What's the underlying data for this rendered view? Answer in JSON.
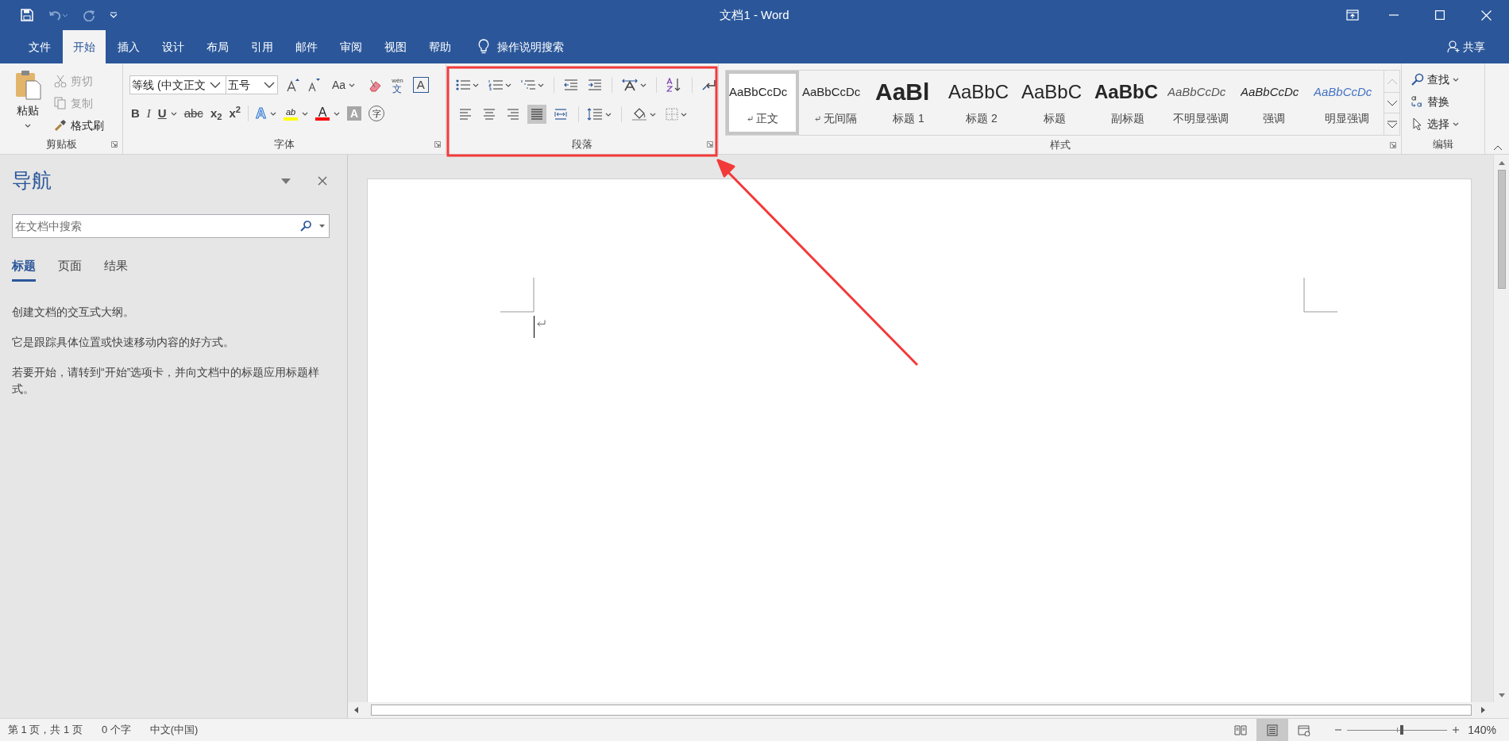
{
  "title_bar": {
    "title": "文档1  -  Word"
  },
  "tabs": [
    {
      "label": "文件",
      "selected": false
    },
    {
      "label": "开始",
      "selected": true
    },
    {
      "label": "插入",
      "selected": false
    },
    {
      "label": "设计",
      "selected": false
    },
    {
      "label": "布局",
      "selected": false
    },
    {
      "label": "引用",
      "selected": false
    },
    {
      "label": "邮件",
      "selected": false
    },
    {
      "label": "审阅",
      "selected": false
    },
    {
      "label": "视图",
      "selected": false
    },
    {
      "label": "帮助",
      "selected": false
    }
  ],
  "tell_me": "操作说明搜索",
  "share": "共享",
  "clipboard": {
    "label": "剪贴板",
    "paste": "粘贴",
    "items": [
      {
        "label": "剪切",
        "kind": "cut",
        "disabled": true
      },
      {
        "label": "复制",
        "kind": "copy",
        "disabled": true
      },
      {
        "label": "格式刷",
        "kind": "brush",
        "disabled": false
      }
    ]
  },
  "font": {
    "label": "字体",
    "font_name": "等线 (中文正文",
    "font_size": "五号",
    "case_button": "Aa",
    "phonetic_top": "wén",
    "phonetic_bottom": "文",
    "border_char": "A",
    "buttons": [
      {
        "label": "B",
        "kind": "bold"
      },
      {
        "label": "I",
        "kind": "italic"
      },
      {
        "label": "U",
        "kind": "underline"
      },
      {
        "label": "abc",
        "kind": "strike"
      },
      {
        "label": "x$_{2}$",
        "kind": "sub"
      },
      {
        "label": "x$^{2}$",
        "kind": "sup"
      }
    ],
    "color_buttons": [
      {
        "label": "A",
        "kind": "effects"
      },
      {
        "label": "ab",
        "kind": "highlight",
        "color": "#ffff00"
      },
      {
        "label": "A",
        "kind": "fontcolor",
        "color": "#ff0000"
      },
      {
        "label": "A",
        "kind": "shade"
      },
      {
        "label": "字",
        "kind": "enclose"
      }
    ]
  },
  "paragraph": {
    "label": "段落",
    "alignment": [
      {
        "selected": false
      },
      {
        "selected": false
      },
      {
        "selected": false
      },
      {
        "selected": true
      },
      {
        "selected": false
      }
    ]
  },
  "styles": {
    "label": "样式",
    "items": [
      {
        "preview": "AaBbCcDc",
        "name": "正文",
        "kind": "normal",
        "mark": true,
        "selected": true
      },
      {
        "preview": "AaBbCcDc",
        "name": "无间隔",
        "kind": "normal",
        "mark": true,
        "selected": false
      },
      {
        "preview": "AaBl",
        "name": "标题 1",
        "kind": "h1",
        "mark": false,
        "selected": false
      },
      {
        "preview": "AaBbC",
        "name": "标题 2",
        "kind": "h2",
        "mark": false,
        "selected": false
      },
      {
        "preview": "AaBbC",
        "name": "标题",
        "kind": "h2",
        "mark": false,
        "selected": false
      },
      {
        "preview": "AaBbC",
        "name": "副标题",
        "kind": "bold",
        "mark": false,
        "selected": false
      },
      {
        "preview": "AaBbCcDc",
        "name": "不明显强调",
        "kind": "subtle",
        "mark": false,
        "selected": false
      },
      {
        "preview": "AaBbCcDc",
        "name": "强调",
        "kind": "emphasis",
        "mark": false,
        "selected": false
      },
      {
        "preview": "AaBbCcDc",
        "name": "明显强调",
        "kind": "intense",
        "mark": false,
        "selected": false
      }
    ]
  },
  "editing": {
    "label": "编辑",
    "items": [
      {
        "label": "查找",
        "kind": "find",
        "dropdown": true
      },
      {
        "label": "替换",
        "kind": "replace",
        "dropdown": false
      },
      {
        "label": "选择",
        "kind": "select",
        "dropdown": true
      }
    ]
  },
  "navigation": {
    "title": "导航",
    "search": {
      "placeholder": "在文档中搜索"
    },
    "tabs": [
      {
        "label": "标题",
        "selected": true
      },
      {
        "label": "页面",
        "selected": false
      },
      {
        "label": "结果",
        "selected": false
      }
    ],
    "paragraphs": [
      "创建文档的交互式大纲。",
      "它是跟踪具体位置或快速移动内容的好方式。",
      "若要开始，请转到“开始”选项卡，并向文档中的标题应用标题样式。"
    ]
  },
  "status_bar": {
    "items": [
      "第 1 页，共 1 页",
      "0 个字",
      "中文(中国)"
    ],
    "views": [
      {
        "kind": "read",
        "selected": false
      },
      {
        "kind": "print",
        "selected": true
      },
      {
        "kind": "web",
        "selected": false
      }
    ],
    "zoom": {
      "level": 0.55,
      "reading": "140%"
    }
  }
}
